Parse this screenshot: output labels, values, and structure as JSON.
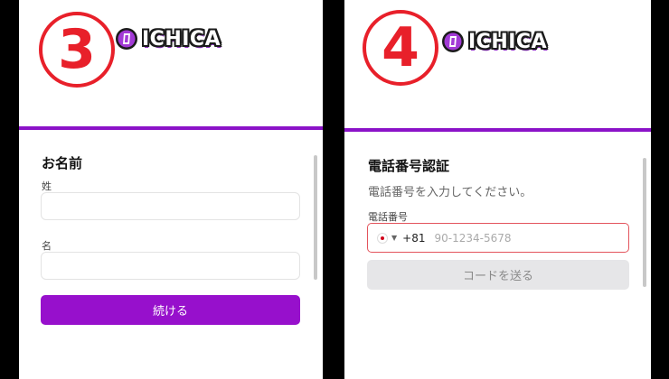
{
  "panel3": {
    "step_number": "3",
    "brand": "ICHICA",
    "section_title": "お名前",
    "last_name_label": "姓",
    "first_name_label": "名",
    "continue_button": "続ける"
  },
  "panel4": {
    "step_number": "4",
    "brand": "ICHICA",
    "section_title": "電話番号認証",
    "description": "電話番号を入力してください。",
    "phone_label": "電話番号",
    "country_code": "+81",
    "phone_placeholder": "90-1234-5678",
    "send_code_button": "コードを送る"
  },
  "colors": {
    "accent_purple": "#8b12c8",
    "button_purple": "#9710cc",
    "step_red": "#e8202a",
    "error_border": "#e3545c"
  },
  "icons": {
    "logo": "ichica-logo-icon",
    "flag": "japan-flag-icon",
    "caret": "chevron-down-icon"
  }
}
